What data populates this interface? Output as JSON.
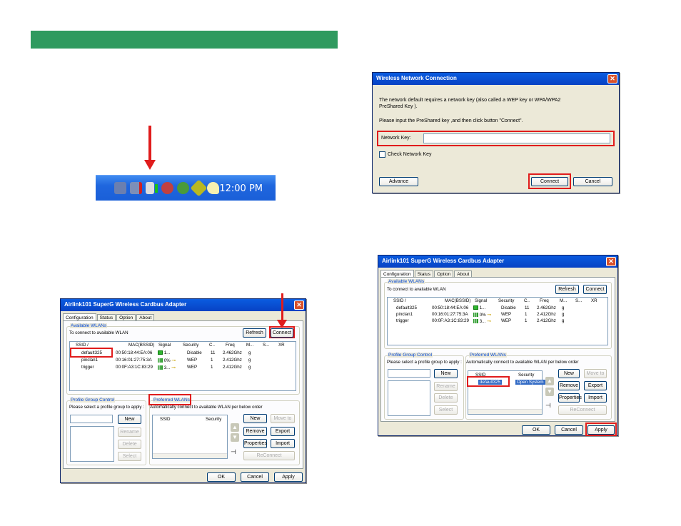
{
  "taskbar": {
    "clock": "12:00 PM"
  },
  "wnc": {
    "title": "Wireless Network Connection",
    "msg1": "The network default requires a network key (also called a WEP key or WPA/WPA2",
    "msg2": "PreShared Key ).",
    "msg3": "Please input the PreShared key ,and then click button \"Connect\".",
    "network_key_label": "Network Key:",
    "network_key_value": "",
    "check_label": "Check Network Key",
    "advance": "Advance",
    "connect": "Connect",
    "cancel": "Cancel"
  },
  "util_left": {
    "title": "Airlink101 SuperG Wireless Cardbus Adapter",
    "tabs": [
      "Configuration",
      "Status",
      "Option",
      "About"
    ],
    "available_label": "Available WLANs",
    "available_hint": "To connect to available WLAN",
    "refresh": "Refresh",
    "connect": "Connect",
    "columns": [
      "SSID  /",
      "MAC(BSSID)",
      "Signal",
      "Security",
      "C..",
      "Freq",
      "M...",
      "S...",
      "XR"
    ],
    "rows": [
      {
        "ssid": "default325",
        "mac": "00:50:18:44:EA:06",
        "signal": "1...",
        "security": "Disable",
        "ch": "11",
        "freq": "2.462Ghz",
        "mode": "g"
      },
      {
        "ssid": "pinclan1",
        "mac": "00:16:01:27:75:3A",
        "signal": "0%",
        "security": "WEP",
        "ch": "1",
        "freq": "2.412Ghz",
        "mode": "g"
      },
      {
        "ssid": "trigger",
        "mac": "00:0F:A3:1C:83:29",
        "signal": "3...",
        "security": "WEP",
        "ch": "1",
        "freq": "2.412Ghz",
        "mode": "g"
      }
    ],
    "profile_label": "Profile Group Control",
    "profile_hint": "Please select a profile group to apply :",
    "new": "New",
    "rename": "Rename",
    "delete": "Delete",
    "select": "Select",
    "preferred_label": "Preferred WLANs",
    "preferred_hint": "Automatically connect to available WLAN per below order",
    "pref_cols": [
      "SSID",
      "Security"
    ],
    "pref_new": "New",
    "move_to": "Move to",
    "remove": "Remove",
    "export": "Export",
    "properties": "Properties",
    "import": "Import",
    "reconnect": "ReConnect",
    "ok": "OK",
    "cancel": "Cancel",
    "apply": "Apply"
  },
  "util_right": {
    "title": "Airlink101 SuperG Wireless Cardbus Adapter",
    "tabs": [
      "Configuration",
      "Status",
      "Option",
      "About"
    ],
    "available_label": "Available WLANs",
    "available_hint": "To connect to available WLAN",
    "refresh": "Refresh",
    "connect": "Connect",
    "columns": [
      "SSID  /",
      "MAC(BSSID)",
      "Signal",
      "Security",
      "C..",
      "Freq",
      "M...",
      "S...",
      "XR"
    ],
    "rows": [
      {
        "ssid": "default325",
        "mac": "00:50:18:44:EA:06",
        "signal": "1...",
        "security": "Disable",
        "ch": "11",
        "freq": "2.462Ghz",
        "mode": "g"
      },
      {
        "ssid": "pinclan1",
        "mac": "00:16:01:27:75:3A",
        "signal": "0%",
        "security": "WEP",
        "ch": "1",
        "freq": "2.412Ghz",
        "mode": "g"
      },
      {
        "ssid": "trigger",
        "mac": "00:0F:A3:1C:83:29",
        "signal": "3...",
        "security": "WEP",
        "ch": "1",
        "freq": "2.412Ghz",
        "mode": "g"
      }
    ],
    "profile_label": "Profile Group Control",
    "profile_hint": "Please select a profile group to apply :",
    "new": "New",
    "rename": "Rename",
    "delete": "Delete",
    "select": "Select",
    "preferred_label": "Preferred WLANs",
    "preferred_hint": "Automatically connect to available WLAN per below order",
    "pref_cols": [
      "SSID",
      "Security"
    ],
    "pref_row": {
      "ssid": "default325",
      "security": "Open System"
    },
    "pref_new": "New",
    "move_to": "Move to",
    "remove": "Remove",
    "export": "Export",
    "properties": "Properties",
    "import": "Import",
    "reconnect": "ReConnect",
    "ok": "OK",
    "cancel": "Cancel",
    "apply": "Apply"
  }
}
